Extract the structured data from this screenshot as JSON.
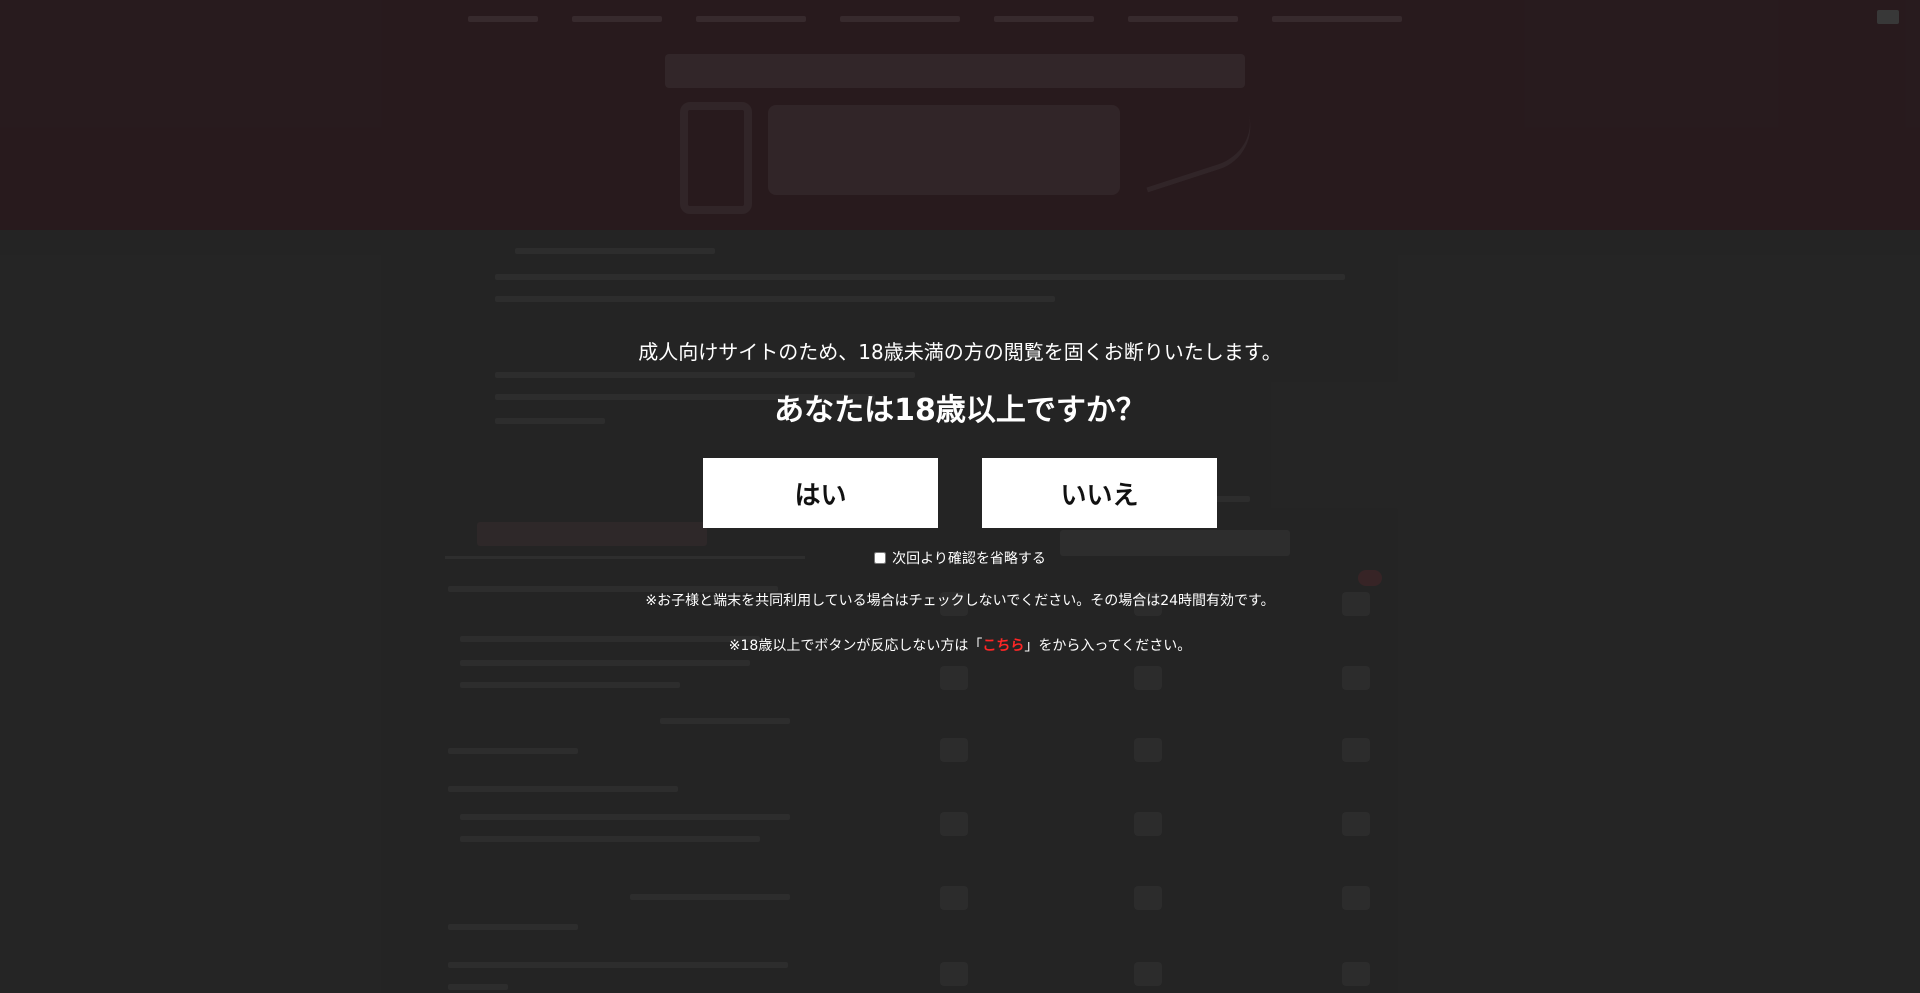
{
  "modal": {
    "notice": "成人向けサイトのため、18歳未満の方の閲覧を固くお断りいたします。",
    "question": "あなたは18歳以上ですか？",
    "yes_label": "はい",
    "no_label": "いいえ",
    "skip_label": "次回より確認を省略する",
    "note_shared_device": "※お子様と端末を共同利用している場合はチェックしないでください。その場合は24時間有効です。",
    "note_fallback_prefix": "※18歳以上でボタンが反応しない方は「",
    "note_fallback_link": "こちら",
    "note_fallback_suffix": "」をから入ってください。"
  },
  "colors": {
    "page_background": "#262626",
    "header_background": "#2a1c1f",
    "button_background": "#ffffff",
    "link_accent": "#ff2626"
  },
  "icons": [
    "site-logo",
    "phone-icon",
    "menu-grid-icons"
  ]
}
